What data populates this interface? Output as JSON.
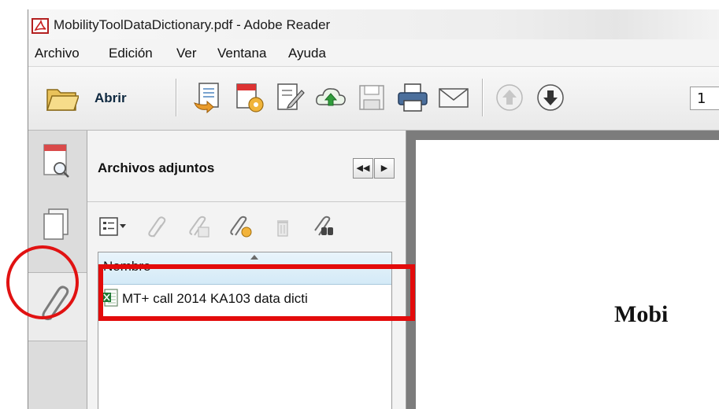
{
  "window": {
    "title": "MobilityToolDataDictionary.pdf - Adobe Reader"
  },
  "menu": {
    "items": [
      "Archivo",
      "Edición",
      "Ver",
      "Ventana",
      "Ayuda"
    ]
  },
  "toolbar": {
    "open_label": "Abrir",
    "page_number": "1",
    "icons": [
      "open-folder-icon",
      "create-pdf-icon",
      "convert-icon",
      "sign-icon",
      "cloud-upload-icon",
      "save-icon",
      "print-icon",
      "email-icon",
      "page-up-icon",
      "page-down-icon"
    ]
  },
  "nav": {
    "buttons": [
      "search-page-icon",
      "pages-icon",
      "attachments-paperclip-icon"
    ],
    "active": "attachments"
  },
  "attachments_panel": {
    "title": "Archivos adjuntos",
    "column_header": "Nombre",
    "files": [
      {
        "name": "MT+ call 2014 KA103 data dicti"
      }
    ]
  },
  "document": {
    "visible_text": "Mobi"
  },
  "colors": {
    "annotation": "#e11212",
    "accent": "#2a68b1"
  }
}
